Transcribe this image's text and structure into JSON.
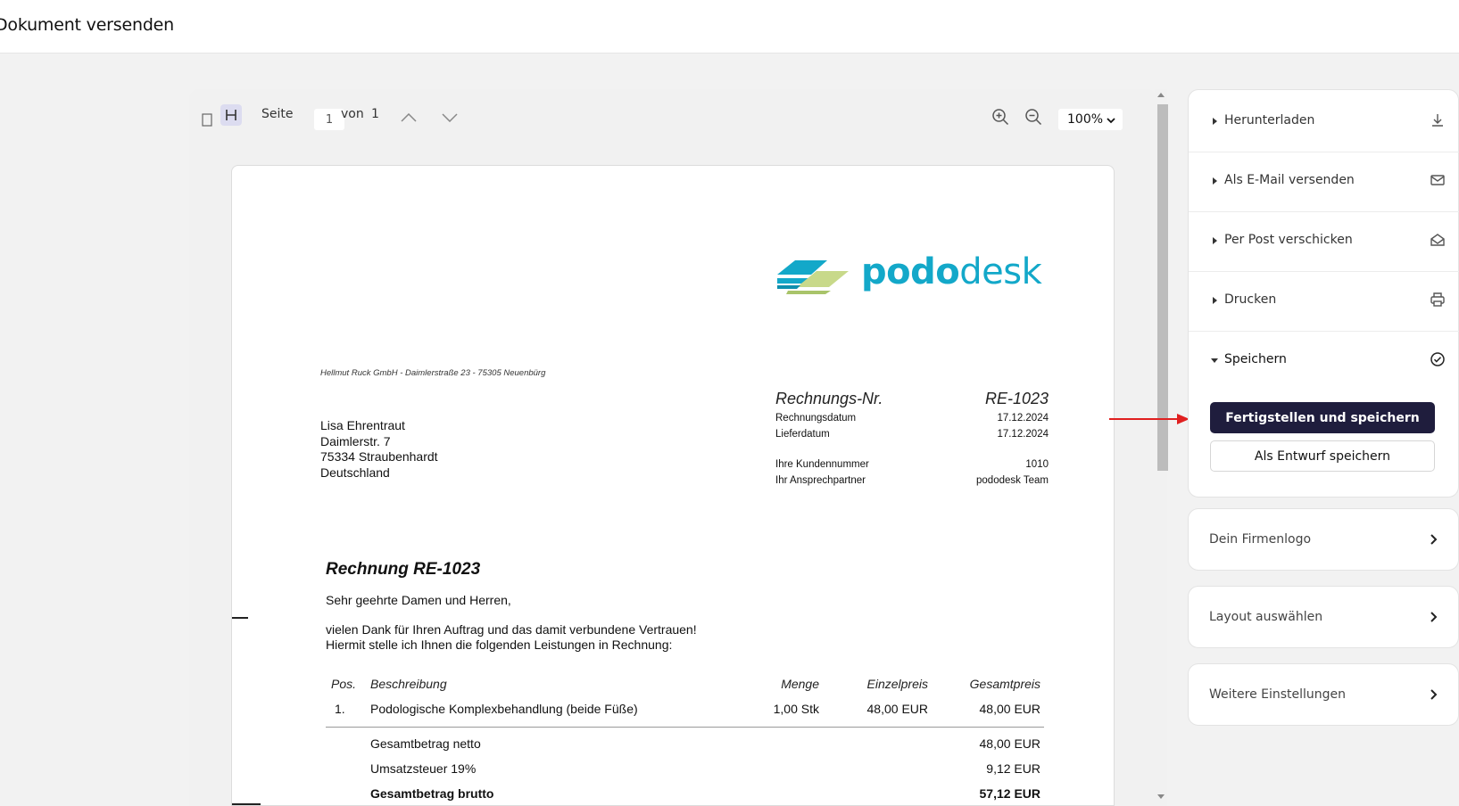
{
  "header": {
    "title": "Dokument versenden"
  },
  "viewer": {
    "page_label": "Seite",
    "page_value": "1",
    "of_label": "von",
    "page_total": "1",
    "zoom": "100%"
  },
  "document": {
    "logo": {
      "part1": "podo",
      "part2": "desk"
    },
    "sender_line": "Hellmut Ruck GmbH - Daimlerstraße 23 - 75305 Neuenbürg",
    "recipient": [
      "Lisa Ehrentraut",
      "Daimlerstr. 7",
      "75334 Straubenhardt",
      "Deutschland"
    ],
    "meta": {
      "invoice_no_label": "Rechnungs-Nr.",
      "invoice_no": "RE-1023",
      "invoice_date_label": "Rechnungsdatum",
      "invoice_date": "17.12.2024",
      "delivery_date_label": "Lieferdatum",
      "delivery_date": "17.12.2024",
      "customer_no_label": "Ihre Kundennummer",
      "customer_no": "1010",
      "contact_label": "Ihr Ansprechpartner",
      "contact": "pododesk Team"
    },
    "title": "Rechnung RE-1023",
    "greeting": "Sehr geehrte Damen und Herren,",
    "intro_line1": "vielen Dank für Ihren Auftrag und das damit verbundene Vertrauen!",
    "intro_line2": "Hiermit stelle ich Ihnen die folgenden Leistungen in Rechnung:",
    "table": {
      "headers": {
        "pos": "Pos.",
        "desc": "Beschreibung",
        "qty": "Menge",
        "unit": "Einzelpreis",
        "total": "Gesamtpreis"
      },
      "rows": [
        {
          "pos": "1.",
          "desc": "Podologische Komplexbehandlung (beide Füße)",
          "qty": "1,00 Stk",
          "unit": "48,00 EUR",
          "total": "48,00 EUR"
        }
      ],
      "net_label": "Gesamtbetrag netto",
      "net_value": "48,00 EUR",
      "vat_label": "Umsatzsteuer 19%",
      "vat_value": "9,12 EUR",
      "gross_label": "Gesamtbetrag brutto",
      "gross_value": "57,12 EUR"
    }
  },
  "panel": {
    "download": "Herunterladen",
    "email": "Als E-Mail versenden",
    "post": "Per Post verschicken",
    "print": "Drucken",
    "save": "Speichern",
    "finalize_button": "Fertigstellen und speichern",
    "draft_button": "Als Entwurf speichern"
  },
  "cards": {
    "logo": "Dein Firmenlogo",
    "layout": "Layout auswählen",
    "settings": "Weitere Einstellungen"
  },
  "colors": {
    "primary": "#1f1d3d",
    "logo": "#13a8c9",
    "annotation_arrow": "#e02020"
  }
}
